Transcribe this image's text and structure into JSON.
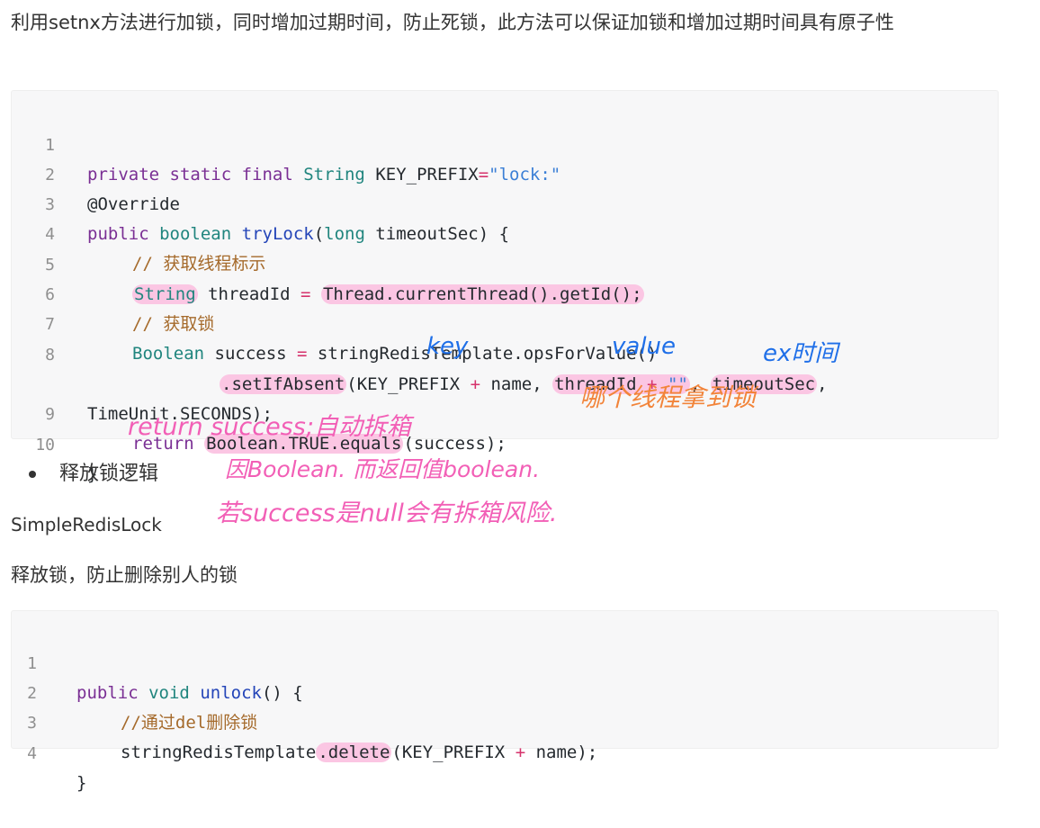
{
  "intro": "利用setnx方法进行加锁，同时增加过期时间，防止死锁，此方法可以保证加锁和增加过期时间具有原子性",
  "code1": {
    "lines": [
      {
        "n": "1",
        "t": "private static final String KEY_PREFIX=\"lock:\""
      },
      {
        "n": "2",
        "t": "@Override"
      },
      {
        "n": "3",
        "t": "public boolean tryLock(long timeoutSec) {"
      },
      {
        "n": "4",
        "t": "// 获取线程标示"
      },
      {
        "n": "5",
        "t": "String threadId = Thread.currentThread().getId();"
      },
      {
        "n": "6",
        "t": "// 获取锁"
      },
      {
        "n": "7",
        "t": "Boolean success = stringRedisTemplate.opsForValue()"
      },
      {
        "n": "8",
        "t": ".setIfAbsent(KEY_PREFIX + name, threadId + \"\", timeoutSec,"
      },
      {
        "n": "",
        "t": "TimeUnit.SECONDS);"
      },
      {
        "n": "9",
        "t": "return Boolean.TRUE.equals(success);"
      },
      {
        "n": "10",
        "t": "}"
      }
    ]
  },
  "bullet": "释放锁逻辑",
  "class_name": "SimpleRedisLock",
  "release_desc": "释放锁，防止删除别人的锁",
  "code2": {
    "lines": [
      {
        "n": "1",
        "t": "public void unlock() {"
      },
      {
        "n": "2",
        "t": "//通过del删除锁"
      },
      {
        "n": "3",
        "t": "stringRedisTemplate.delete(KEY_PREFIX + name);"
      },
      {
        "n": "4",
        "t": "}"
      }
    ]
  },
  "annotations": {
    "key": "key",
    "value": "value",
    "ex": "ex时间",
    "which_thread": "哪个线程拿到锁",
    "return_note": "return success;自动拆箱",
    "boolean_note": "因Boolean. 而返回值boolean.",
    "null_note": "若success是null会有拆箱风险."
  },
  "colors": {
    "highlight": "#fbc6e3",
    "pink_ink": "#f25fb6",
    "blue_ink": "#1f6fe8",
    "orange_ink": "#f2843a"
  }
}
